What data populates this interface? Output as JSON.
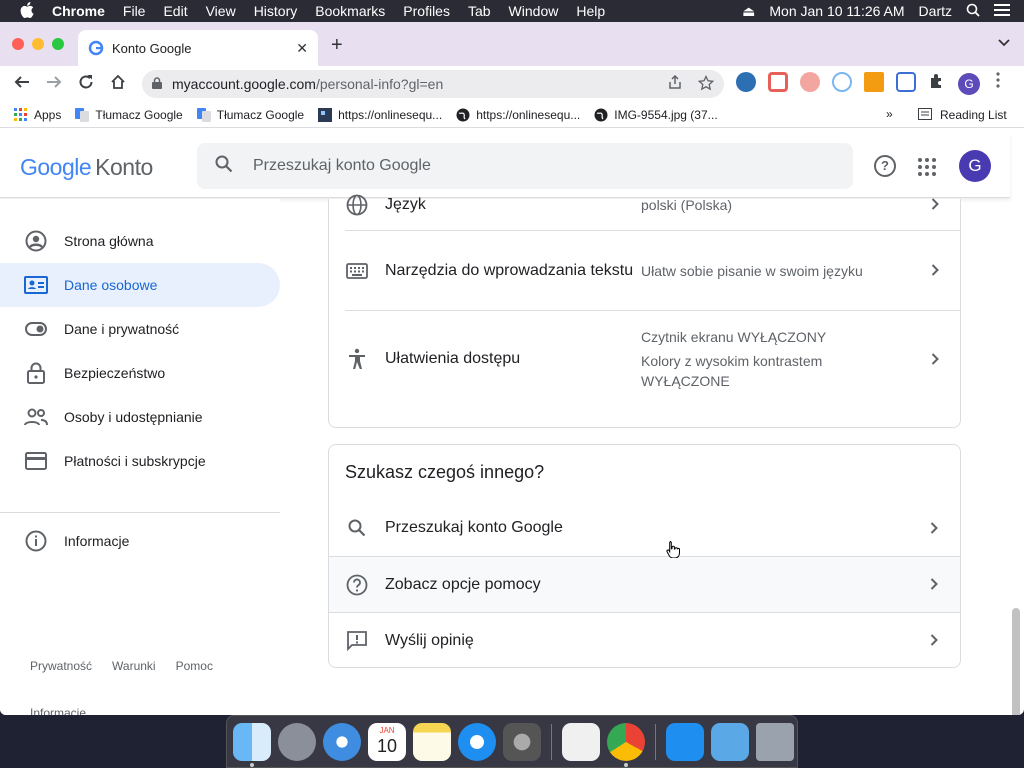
{
  "menubar": {
    "app": "Chrome",
    "items": [
      "File",
      "Edit",
      "View",
      "History",
      "Bookmarks",
      "Profiles",
      "Tab",
      "Window",
      "Help"
    ],
    "datetime": "Mon Jan 10  11:26 AM",
    "user": "Dartz"
  },
  "browser": {
    "tab_title": "Konto Google",
    "url_host": "myaccount.google.com",
    "url_path": "/personal-info?gl=en",
    "profile_initial": "G",
    "bookmarks": [
      {
        "label": "Apps"
      },
      {
        "label": "Tłumacz Google"
      },
      {
        "label": "Tłumacz Google"
      },
      {
        "label": "https://onlinesequ..."
      },
      {
        "label": "https://onlinesequ..."
      },
      {
        "label": "IMG-9554.jpg (37..."
      }
    ],
    "bookmarks_overflow": "»",
    "reading_list": "Reading List"
  },
  "header": {
    "logo_google": "Google",
    "logo_konto": "Konto",
    "search_placeholder": "Przeszukaj konto Google",
    "avatar_initial": "G"
  },
  "sidebar": {
    "items": [
      {
        "label": "Strona główna"
      },
      {
        "label": "Dane osobowe"
      },
      {
        "label": "Dane i prywatność"
      },
      {
        "label": "Bezpieczeństwo"
      },
      {
        "label": "Osoby i udostępnianie"
      },
      {
        "label": "Płatności i subskrypcje"
      },
      {
        "label": "Informacje"
      }
    ],
    "footer": [
      "Prywatność",
      "Warunki",
      "Pomoc"
    ],
    "footer_info": "Informacje"
  },
  "settings": {
    "rows": [
      {
        "title": "Język",
        "value": "polski (Polska)"
      },
      {
        "title": "Narzędzia do wprowadzania tekstu",
        "value": "Ułatw sobie pisanie w swoim języku"
      },
      {
        "title": "Ułatwienia dostępu",
        "value_line1": "Czytnik ekranu WYŁĄCZONY",
        "value_line2": "Kolory z wysokim kontrastem WYŁĄCZONE"
      }
    ]
  },
  "other": {
    "heading": "Szukasz czegoś innego?",
    "rows": [
      {
        "title": "Przeszukaj konto Google"
      },
      {
        "title": "Zobacz opcje pomocy"
      },
      {
        "title": "Wyślij opinię"
      }
    ]
  },
  "dock": {
    "calendar_month": "JAN",
    "calendar_day": "10"
  },
  "colors": {
    "accent": "#1967d2",
    "active_bg": "#e8f0fe",
    "avatar": "#4a3ab2"
  }
}
